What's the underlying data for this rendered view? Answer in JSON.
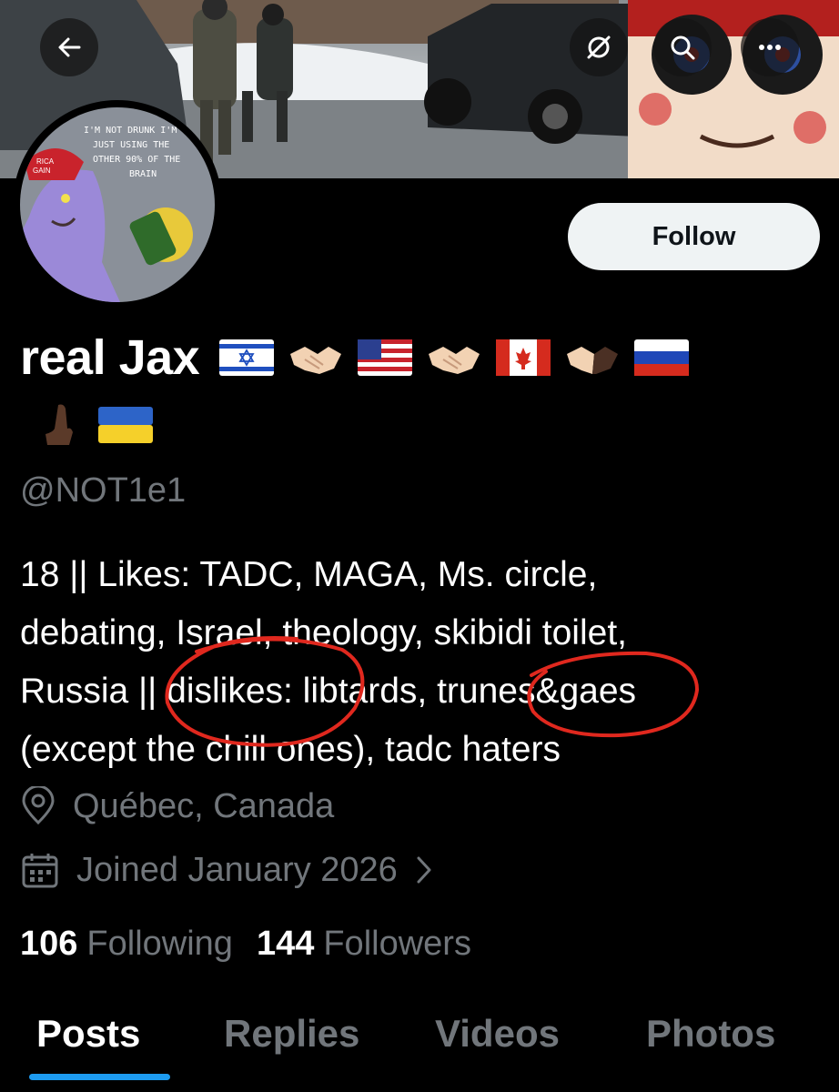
{
  "header": {
    "back_icon": "arrow-left-icon",
    "hide_icon": "no-mute-icon",
    "search_icon": "search-icon",
    "more_icon": "more-icon"
  },
  "avatar": {
    "caption_lines": [
      "I'M NOT DRUNK I'M",
      "JUST USING THE",
      "OTHER 90% OF THE",
      "BRAIN"
    ],
    "hat_text": [
      "RICA",
      "GAIN"
    ]
  },
  "follow_button": {
    "label": "Follow"
  },
  "profile": {
    "display_name": "real Jax",
    "handle": "@NOT1e1"
  },
  "bio": {
    "lines": [
      "18 || Likes: TADC, MAGA, Ms. circle,",
      "debating, Israel, theology, skibidi toilet,",
      "Russia || dislikes: libtards, trunes&gaes",
      "(except the chill ones), tadc haters"
    ]
  },
  "location": {
    "icon": "location-pin-icon",
    "text": "Québec, Canada"
  },
  "joined": {
    "icon": "calendar-icon",
    "text": "Joined January 2026"
  },
  "stats": {
    "following_count": "106",
    "following_label": "Following",
    "followers_count": "144",
    "followers_label": "Followers"
  },
  "tabs": [
    "Posts",
    "Replies",
    "Videos",
    "Photos"
  ],
  "active_tab": "Posts",
  "colors": {
    "background": "#000000",
    "text": "#ffffff",
    "muted": "#71767b",
    "accent": "#1d9bf0",
    "annotation": "#e0281e"
  }
}
